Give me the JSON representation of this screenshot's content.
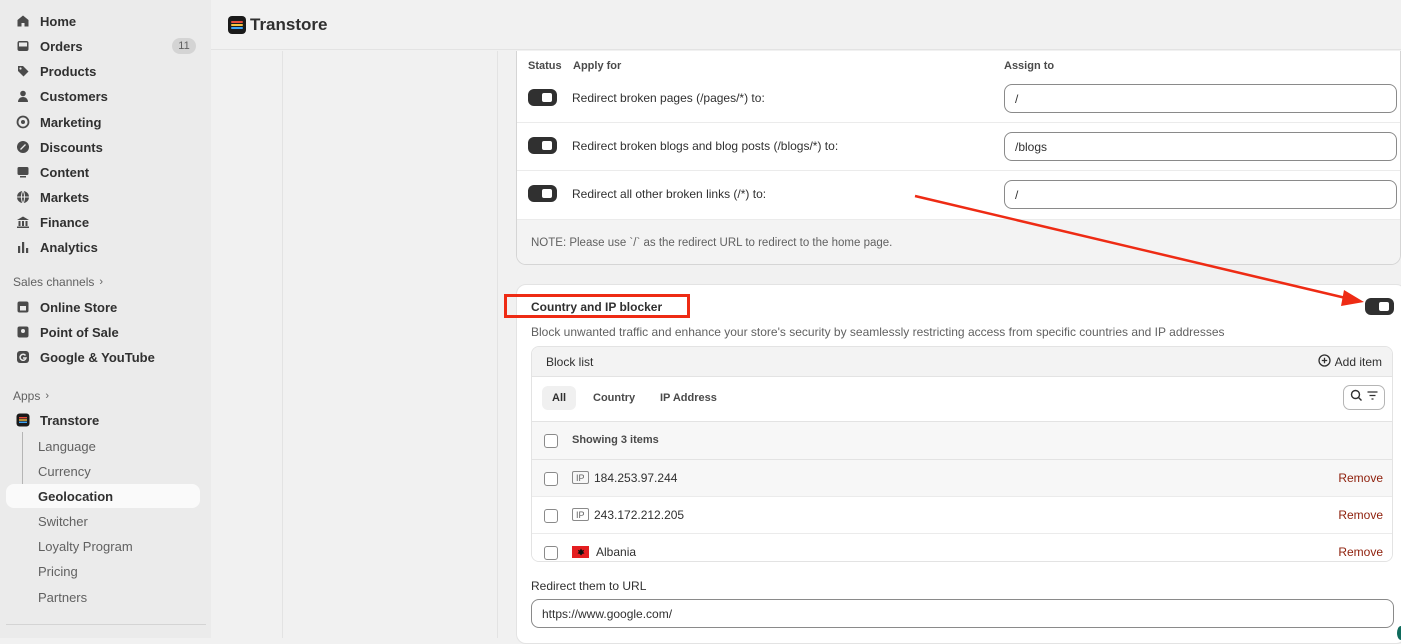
{
  "app": {
    "title": "Transtore",
    "logo_colors": [
      "#e64b3c",
      "#f5c342",
      "#3da3f5"
    ]
  },
  "sidebar": {
    "nav": [
      {
        "label": "Home",
        "icon": "home-icon"
      },
      {
        "label": "Orders",
        "icon": "inbox-icon",
        "badge": "11"
      },
      {
        "label": "Products",
        "icon": "tag-icon"
      },
      {
        "label": "Customers",
        "icon": "person-icon"
      },
      {
        "label": "Marketing",
        "icon": "target-icon"
      },
      {
        "label": "Discounts",
        "icon": "discount-icon"
      },
      {
        "label": "Content",
        "icon": "content-icon"
      },
      {
        "label": "Markets",
        "icon": "globe-icon"
      },
      {
        "label": "Finance",
        "icon": "bank-icon"
      },
      {
        "label": "Analytics",
        "icon": "bar-chart-icon"
      }
    ],
    "sales_channels_label": "Sales channels",
    "sales_channels": [
      {
        "label": "Online Store",
        "icon": "store-icon"
      },
      {
        "label": "Point of Sale",
        "icon": "pos-icon"
      },
      {
        "label": "Google & YouTube",
        "icon": "google-icon"
      }
    ],
    "apps_label": "Apps",
    "app_name": "Transtore",
    "app_subitems": [
      "Language",
      "Currency",
      "Geolocation",
      "Switcher",
      "Loyalty Program",
      "Pricing",
      "Partners"
    ],
    "active_subitem": "Geolocation"
  },
  "redirect_card": {
    "col_status": "Status",
    "col_apply": "Apply for",
    "col_assign": "Assign to",
    "rows": [
      {
        "label": "Redirect broken pages (/pages/*) to:",
        "value": "/",
        "enabled": true
      },
      {
        "label": "Redirect broken blogs and blog posts (/blogs/*) to:",
        "value": "/blogs",
        "enabled": true
      },
      {
        "label": "Redirect all other broken links (/*) to:",
        "value": "/",
        "enabled": true
      }
    ],
    "note": "NOTE: Please use `/` as the redirect URL to redirect to the home page."
  },
  "blocker_card": {
    "title": "Country and IP blocker",
    "description": "Block unwanted traffic and enhance your store's security by seamlessly restricting access from specific countries and IP addresses",
    "enabled": true,
    "block_list_title": "Block list",
    "add_item_label": "Add item",
    "tabs": [
      "All",
      "Country",
      "IP Address"
    ],
    "active_tab": "All",
    "showing_text": "Showing 3 items",
    "items": [
      {
        "type": "ip",
        "tag": "IP",
        "value": "184.253.97.244",
        "action": "Remove"
      },
      {
        "type": "ip",
        "tag": "IP",
        "value": "243.172.212.205",
        "action": "Remove"
      },
      {
        "type": "country",
        "flag": "albania-flag-icon",
        "value": "Albania",
        "action": "Remove"
      }
    ],
    "redirect_label": "Redirect them to URL",
    "redirect_value": "https://www.google.com/"
  },
  "annotation": {
    "color": "#ee2b14"
  }
}
